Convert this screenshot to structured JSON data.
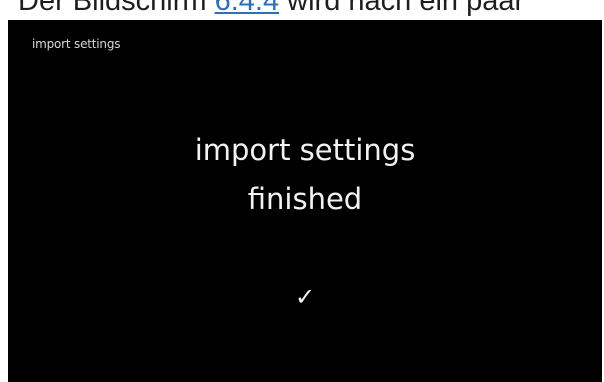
{
  "document": {
    "caption_before": "Der Bildschirm ",
    "caption_link": "6.4.4",
    "caption_after": " wird nach ein paar"
  },
  "screen": {
    "title": "import settings",
    "message_line1": "import settings",
    "message_line2": "finished",
    "status_icon": "checkmark-icon",
    "check_glyph": "✓"
  }
}
